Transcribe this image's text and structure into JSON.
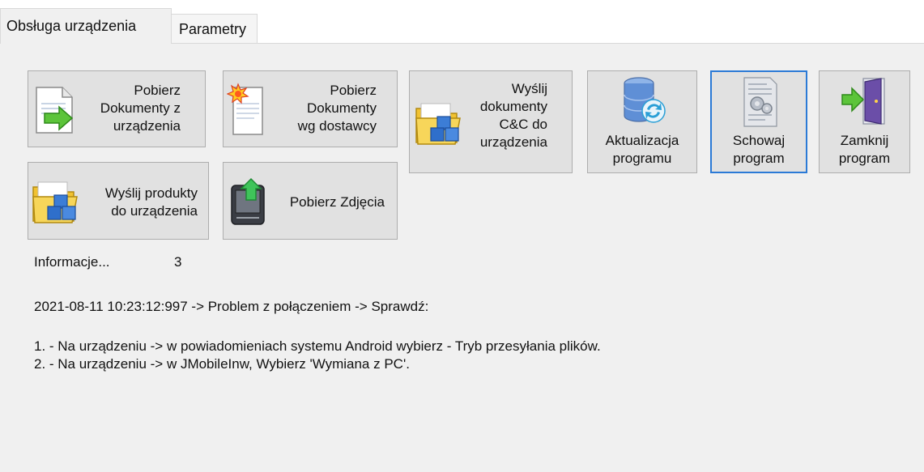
{
  "tabs": {
    "active": "Obsługa urządzenia",
    "inactive": "Parametry"
  },
  "buttons": {
    "download_docs": [
      "Pobierz",
      "Dokumenty z",
      "urządzenia"
    ],
    "download_supplier": [
      "Pobierz",
      "Dokumenty",
      "wg dostawcy"
    ],
    "send_cc": [
      "Wyślij",
      "dokumenty",
      "C&C do",
      "urządzenia"
    ],
    "update": [
      "Aktualizacja",
      "programu"
    ],
    "hide": [
      "Schowaj",
      "program"
    ],
    "close": [
      "Zamknij",
      "program"
    ],
    "send_products": [
      "Wyślij produkty",
      "do urządzenia"
    ],
    "download_photos": "Pobierz Zdjęcia"
  },
  "info": {
    "label": "Informacje...",
    "count": "3",
    "message": "2021-08-11 10:23:12:997 -> Problem z połączeniem -> Sprawdź:",
    "steps": [
      "1. - Na urządzeniu -> w powiadomieniach systemu Android wybierz - Tryb przesyłania plików.",
      "2. - Na urządzeniu -> w JMobileInw, Wybierz 'Wymiana z PC'."
    ]
  },
  "icons": {
    "download_docs": "document-green-arrow-icon",
    "download_supplier": "document-starburst-icon",
    "send_cc": "folder-cubes-icon",
    "update": "database-sync-icon",
    "hide": "document-gears-icon",
    "close": "door-exit-icon",
    "send_products": "folder-cubes-icon",
    "download_photos": "device-upload-icon"
  }
}
